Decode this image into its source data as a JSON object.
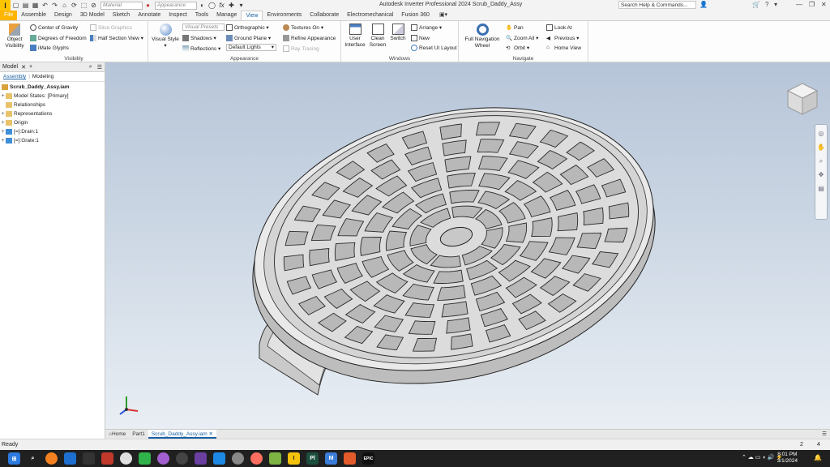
{
  "app_title": "Autodesk Inverter Professional 2024   Scrub_Daddy_Assy",
  "qat": {
    "material": "Material",
    "appearance": "Appearance"
  },
  "search": {
    "placeholder": "Search Help & Commands..."
  },
  "ribbon_tabs": [
    "File",
    "Assemble",
    "Design",
    "3D Model",
    "Sketch",
    "Annotate",
    "Inspect",
    "Tools",
    "Manage",
    "View",
    "Environments",
    "Collaborate",
    "Electromechanical",
    "Fusion 360"
  ],
  "active_tab": "View",
  "visibility": {
    "label": "Visibility",
    "object_visibility": "Object Visibility",
    "center_of_gravity": "Center of Gravity",
    "degrees_of_freedom": "Degrees of Freedom",
    "imate_glyphs": "iMate Glyphs",
    "slice_graphics": "Slice Graphics",
    "half_section_view": "Half Section View"
  },
  "appearance": {
    "label": "Appearance",
    "visual_style": "Visual Style",
    "visual_presets": "Visual Presets",
    "orthographic": "Orthographic",
    "textures_on": "Textures On",
    "shadows": "Shadows",
    "ground_plane": "Ground Plane",
    "refine_appearance": "Refine Appearance",
    "reflections": "Reflections",
    "default_lights": "Default Lights",
    "ray_tracing": "Ray Tracing"
  },
  "windows": {
    "label": "Windows",
    "user_interface": "User Interface",
    "clean_screen": "Clean Screen",
    "switch": "Switch",
    "arrange": "Arrange",
    "new": "New",
    "reset_ui": "Reset UI Layout"
  },
  "navigate": {
    "label": "Navigate",
    "full_nav_wheel": "Full Navigation Wheel",
    "pan": "Pan",
    "zoom_all": "Zoom All",
    "orbit": "Orbit",
    "look_at": "Look At",
    "previous": "Previous",
    "home_view": "Home View"
  },
  "browser": {
    "title": "Model",
    "subtab_assembly": "Assembly",
    "subtab_modeling": "Modeling",
    "items": [
      "Scrub_Daddy_Assy.iam",
      "Model States: [Primary]",
      "Relationships",
      "Representations",
      "Origin",
      "[=]:Drain:1",
      "[=]:Grate:1"
    ]
  },
  "doc_tabs": [
    "Home",
    "Part1",
    "Scrub_Daddy_Assy.iam"
  ],
  "status": {
    "text": "Ready",
    "n1": "2",
    "n2": "4"
  },
  "clock": {
    "time": "8:01 PM",
    "date": "3/1/2024"
  },
  "taskbar_labels": {
    "pl": "Pl",
    "m": "M",
    "epic": "EPIC"
  }
}
